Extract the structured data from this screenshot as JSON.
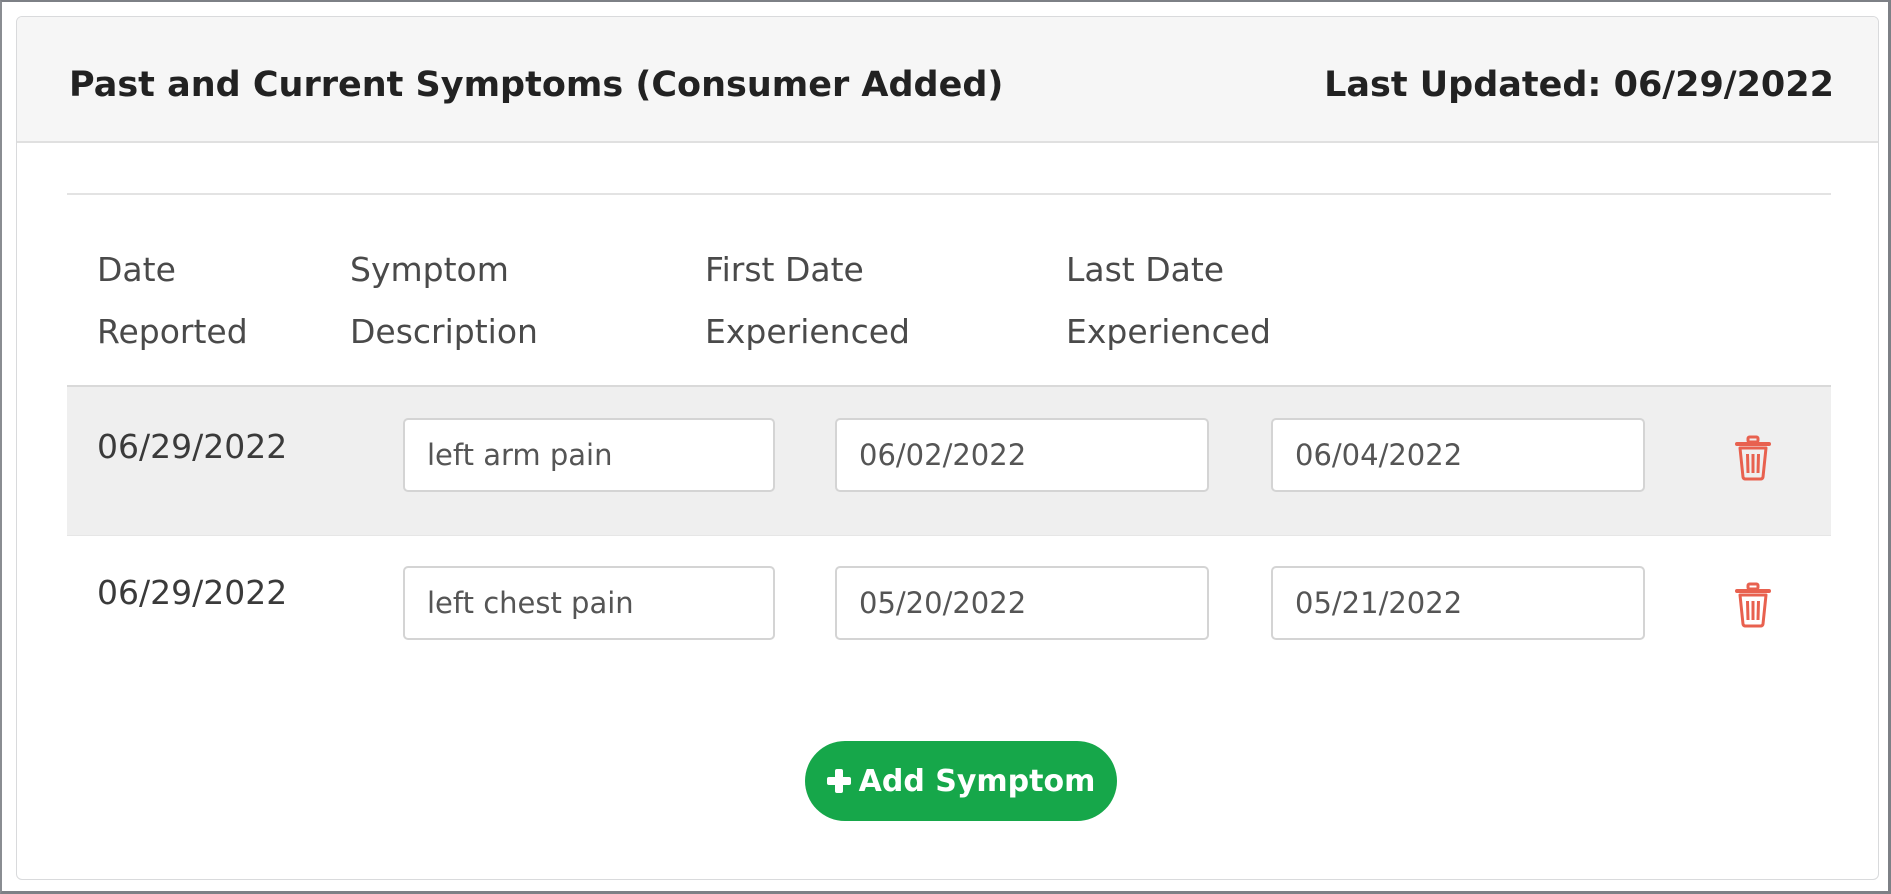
{
  "card": {
    "title": "Past and Current Symptoms (Consumer Added)",
    "last_updated": "Last Updated: 06/29/2022"
  },
  "table": {
    "columns": [
      {
        "line1": "Date",
        "line2": "Reported"
      },
      {
        "line1": "Symptom",
        "line2": "Description"
      },
      {
        "line1": "First Date",
        "line2": "Experienced"
      },
      {
        "line1": "Last Date",
        "line2": "Experienced"
      }
    ],
    "rows": [
      {
        "date_reported": "06/29/2022",
        "description": "left arm pain",
        "first_date": "06/02/2022",
        "last_date": "06/04/2022"
      },
      {
        "date_reported": "06/29/2022",
        "description": "left chest pain",
        "first_date": "05/20/2022",
        "last_date": "05/21/2022"
      }
    ]
  },
  "actions": {
    "add_label": "Add Symptom",
    "add_icon": "plus-icon",
    "delete_icon": "trash-icon"
  },
  "colors": {
    "accent_green": "#16a74a",
    "delete_red": "#e8614f",
    "header_bg": "#f6f6f6",
    "row_alt_bg": "#efefef"
  }
}
